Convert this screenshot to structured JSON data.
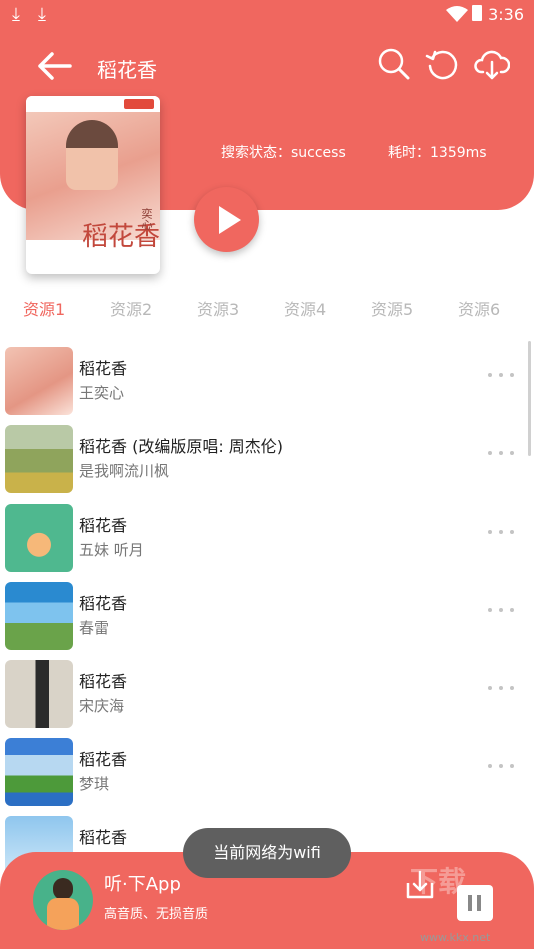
{
  "status_bar": {
    "time": "3:36"
  },
  "header": {
    "title": "稻花香",
    "status_label": "搜索状态：success",
    "time_label": "耗时：1359ms"
  },
  "cover": {
    "title": "稻花香",
    "artist_mark": "奕心"
  },
  "tabs": [
    "资源1",
    "资源2",
    "资源3",
    "资源4",
    "资源5",
    "资源6"
  ],
  "active_tab": 0,
  "songs": [
    {
      "title": "稻花香",
      "artist": "王奕心"
    },
    {
      "title": "稻花香 (改编版原唱: 周杰伦)",
      "artist": "是我啊流川枫"
    },
    {
      "title": "稻花香",
      "artist": "五妹  听月"
    },
    {
      "title": "稻花香",
      "artist": "春雷"
    },
    {
      "title": "稻花香",
      "artist": "宋庆海"
    },
    {
      "title": "稻花香",
      "artist": "梦琪"
    },
    {
      "title": "稻花香",
      "artist": ""
    }
  ],
  "toast": "当前网络为wifi",
  "player": {
    "title": "听·下App",
    "subtitle": "高音质、无损音质"
  },
  "watermark": {
    "text": "下载",
    "url": "www.kkx.net"
  },
  "colors": {
    "accent": "#F0675F"
  }
}
